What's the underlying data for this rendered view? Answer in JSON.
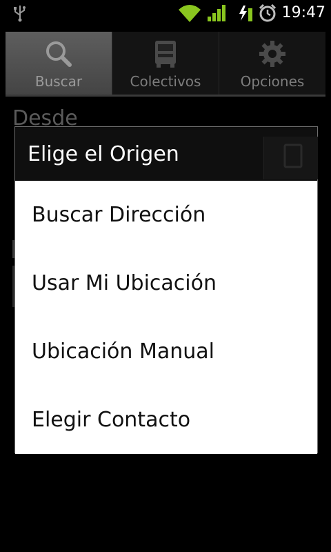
{
  "status_bar": {
    "time": "19:47",
    "icons": [
      "usb-icon",
      "wifi-icon",
      "signal-icon",
      "battery-charging-icon",
      "alarm-icon"
    ],
    "wifi_color": "#8ac61f",
    "signal_color": "#8ac61f"
  },
  "tabs": [
    {
      "label": "Buscar",
      "icon": "search-icon",
      "selected": true
    },
    {
      "label": "Colectivos",
      "icon": "bus-icon",
      "selected": false
    },
    {
      "label": "Opciones",
      "icon": "gear-icon",
      "selected": false
    }
  ],
  "background": {
    "from_label": "Desde"
  },
  "dialog": {
    "title": "Elige el Origen",
    "items": [
      {
        "label": "Buscar Dirección"
      },
      {
        "label": "Usar Mi Ubicación"
      },
      {
        "label": "Ubicación Manual"
      },
      {
        "label": "Elegir Contacto"
      }
    ]
  }
}
